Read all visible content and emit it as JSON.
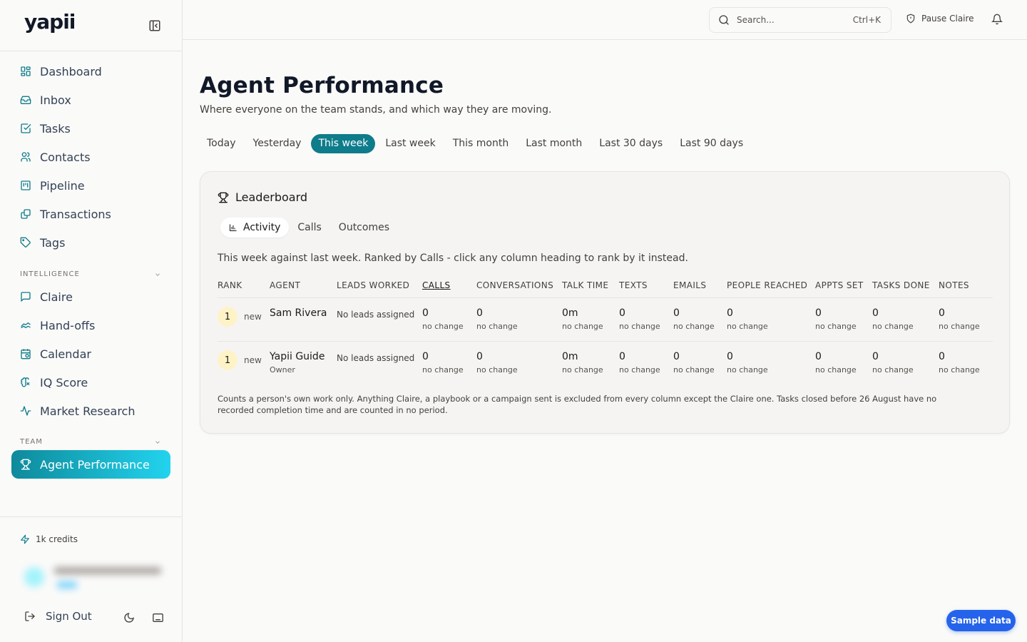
{
  "app": {
    "logo": "yapii",
    "accent": "#0e7c8a"
  },
  "sidebar": {
    "items": [
      {
        "label": "Dashboard",
        "icon": "grid-icon"
      },
      {
        "label": "Inbox",
        "icon": "inbox-icon"
      },
      {
        "label": "Tasks",
        "icon": "checkbox-icon"
      },
      {
        "label": "Contacts",
        "icon": "users-icon"
      },
      {
        "label": "Pipeline",
        "icon": "kanban-icon"
      },
      {
        "label": "Transactions",
        "icon": "transactions-icon"
      },
      {
        "label": "Tags",
        "icon": "tag-icon"
      }
    ],
    "intelligence": {
      "label": "INTELLIGENCE",
      "items": [
        {
          "label": "Claire",
          "icon": "chat-icon"
        },
        {
          "label": "Hand-offs",
          "icon": "handshake-icon"
        },
        {
          "label": "Calendar",
          "icon": "calendar-icon"
        },
        {
          "label": "IQ Score",
          "icon": "brain-icon"
        },
        {
          "label": "Market Research",
          "icon": "activity-icon"
        }
      ]
    },
    "team": {
      "label": "TEAM",
      "items": [
        {
          "label": "Agent Performance",
          "icon": "trophy-icon",
          "active": true
        }
      ]
    },
    "credits": "1k credits",
    "sign_out": "Sign Out"
  },
  "topbar": {
    "search_placeholder": "Search...",
    "search_shortcut": "Ctrl+K",
    "pause_label": "Pause Claire"
  },
  "page": {
    "title": "Agent Performance",
    "subtitle": "Where everyone on the team stands, and which way they are moving.",
    "periods": [
      "Today",
      "Yesterday",
      "This week",
      "Last week",
      "This month",
      "Last month",
      "Last 30 days",
      "Last 90 days"
    ],
    "active_period": "This week"
  },
  "leaderboard": {
    "title": "Leaderboard",
    "tabs": [
      "Activity",
      "Calls",
      "Outcomes"
    ],
    "active_tab": "Activity",
    "description": "This week against last week. Ranked by Calls - click any column heading to rank by it instead.",
    "columns": [
      "RANK",
      "AGENT",
      "LEADS WORKED",
      "CALLS",
      "CONVERSATIONS",
      "TALK TIME",
      "TEXTS",
      "EMAILS",
      "PEOPLE REACHED",
      "APPTS SET",
      "TASKS DONE",
      "NOTES"
    ],
    "sorted_column": "CALLS",
    "rows": [
      {
        "rank": "1",
        "rank_note": "new",
        "agent": "Sam Rivera",
        "role": "",
        "leads": "No leads assigned",
        "values": [
          "0",
          "0",
          "0m",
          "0",
          "0",
          "0",
          "0",
          "0",
          "0"
        ],
        "changes": [
          "no change",
          "no change",
          "no change",
          "no change",
          "no change",
          "no change",
          "no change",
          "no change",
          "no change"
        ]
      },
      {
        "rank": "1",
        "rank_note": "new",
        "agent": "Yapii Guide",
        "role": "Owner",
        "leads": "No leads assigned",
        "values": [
          "0",
          "0",
          "0m",
          "0",
          "0",
          "0",
          "0",
          "0",
          "0"
        ],
        "changes": [
          "no change",
          "no change",
          "no change",
          "no change",
          "no change",
          "no change",
          "no change",
          "no change",
          "no change"
        ]
      }
    ],
    "footnote": "Counts a person's own work only. Anything Claire, a playbook or a campaign sent is excluded from every column except the Claire one. Tasks closed before 26 August have no recorded completion time and are counted in no period."
  },
  "sample_button": "Sample data"
}
